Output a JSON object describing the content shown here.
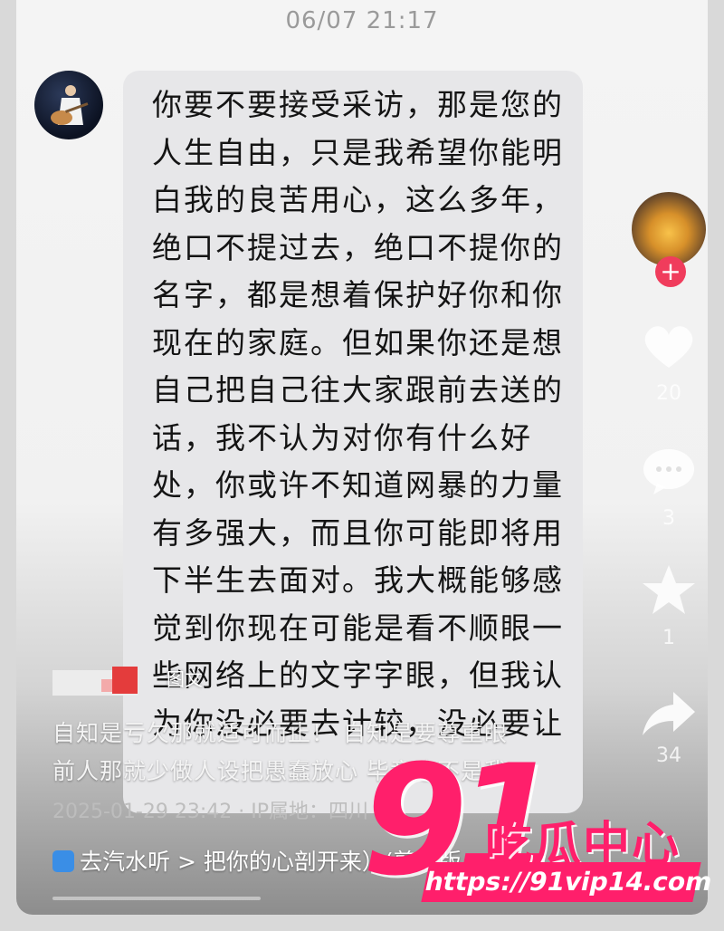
{
  "chat": {
    "timestamp": "06/07 21:17",
    "message_lines": [
      "你要不要接受采访，那是您的",
      "人生自由，只是我希望你能明",
      "白我的良苦用心，这么多年，",
      "绝口不提过去，绝口不提你的",
      "名字，都是想着保护好你和你",
      "现在的家庭。但如果你还是想",
      "自己把自己往大家跟前去送的",
      "话，我不认为对你有什么好",
      "处，你或许不知道网暴的力量",
      "有多强大，而且你可能即将用",
      "下半生去面对。我大概能够感",
      "觉到你现在可能是看不顺眼一",
      "些网络上的文字字眼，但我认",
      "为你没必要去计较，没必要让"
    ]
  },
  "rail": {
    "like_count": "20",
    "comment_count": "3",
    "favorite_count": "1",
    "share_count": "34",
    "follow_symbol": "+"
  },
  "post": {
    "tag": "图文",
    "caption_line1": "自知是亏欠那就适可而止！ 自知是要尊重眼",
    "caption_line2": "前人那就少做人设把愚蠢放心 毕竟这不是我",
    "meta": "2025-01-29 23:42 · IP属地：四川",
    "chip_label": "去汽水听",
    "song": "> 把你的心剖开来）(剪辑版"
  },
  "watermark": {
    "number": "91",
    "name": "吃瓜中心",
    "url": "https://91vip14.com"
  },
  "colors": {
    "brand_pink": "#ff1f6b",
    "follow_red": "#f03c5c",
    "bubble_bg": "#e7e7e9"
  },
  "icons": [
    "heart-icon",
    "comment-icon",
    "star-icon",
    "share-icon",
    "plus-icon"
  ]
}
